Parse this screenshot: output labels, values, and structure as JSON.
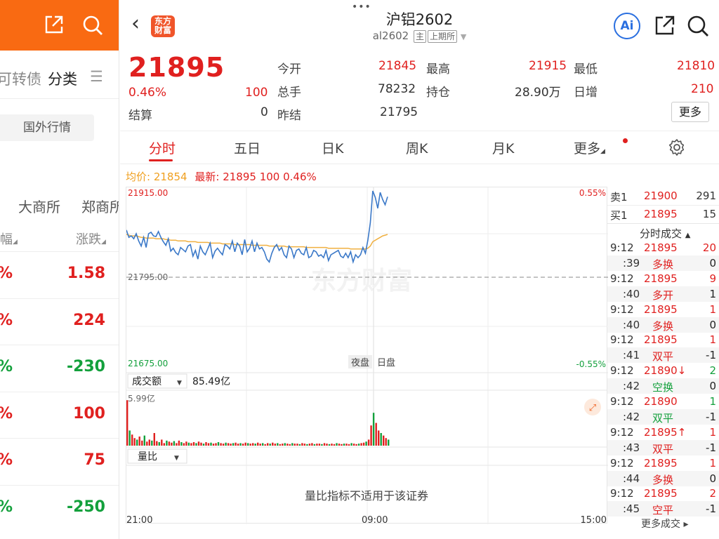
{
  "left_panel": {
    "categories_partial": "可转债",
    "categories_current": "分类",
    "menu_icon": "hamburger-icon",
    "foreign_market_button": "国外行情",
    "exchange_1": "大商所",
    "exchange_2": "郑商所",
    "col_change_pct": "幅",
    "col_change": "涨跌",
    "rows": [
      {
        "pct": "%",
        "change": "1.58",
        "trend": "up"
      },
      {
        "pct": "%",
        "change": "224",
        "trend": "up"
      },
      {
        "pct": "%",
        "change": "-230",
        "trend": "down"
      },
      {
        "pct": "%",
        "change": "100",
        "trend": "up"
      },
      {
        "pct": "%",
        "change": "75",
        "trend": "up"
      },
      {
        "pct": "%",
        "change": "-250",
        "trend": "down"
      }
    ]
  },
  "header": {
    "title": "沪铝2602",
    "code": "al2602",
    "tag_main": "主",
    "exchange": "上期所",
    "logo_text": "东方财富",
    "ai_label": "Ai"
  },
  "quote": {
    "last_price": "21895",
    "change_pct": "0.46%",
    "change": "100",
    "settlement_label": "结算",
    "settlement": "0",
    "open_label": "今开",
    "open": "21845",
    "high_label": "最高",
    "high": "21915",
    "low_label": "最低",
    "low": "21810",
    "volume_label": "总手",
    "volume": "78232",
    "oi_label": "持仓",
    "oi": "28.90万",
    "oi_change_label": "日增",
    "oi_change": "210",
    "prev_settle_label": "昨结",
    "prev_settle": "21795",
    "more_button": "更多"
  },
  "tabs": [
    {
      "label": "分时",
      "active": true
    },
    {
      "label": "五日",
      "active": false
    },
    {
      "label": "日K",
      "active": false
    },
    {
      "label": "周K",
      "active": false
    },
    {
      "label": "月K",
      "active": false
    },
    {
      "label": "更多",
      "active": false
    }
  ],
  "chart_info": {
    "avg_label": "均价:",
    "avg_value": "21854",
    "latest_label": "最新:",
    "latest_value": "21895",
    "latest_change": "100",
    "latest_pct": "0.46%"
  },
  "chart_data": {
    "type": "line",
    "y_max_label": "21915.00",
    "y_mid_label": "21795.00",
    "y_min_label": "21675.00",
    "pct_max_label": "0.55%",
    "pct_min_label": "-0.55%",
    "ylim": [
      21675,
      21915
    ],
    "prev_settle": 21795,
    "session_night_label": "夜盘",
    "session_day_label": "日盘",
    "x_labels": [
      "21:00",
      "09:00",
      "15:00"
    ],
    "price_series": [
      21860,
      21850,
      21852,
      21848,
      21855,
      21845,
      21838,
      21850,
      21836,
      21855,
      21857,
      21852,
      21851,
      21858,
      21850,
      21844,
      21839,
      21848,
      21831,
      21835,
      21829,
      21826,
      21836,
      21833,
      21830,
      21838,
      21840,
      21824,
      21832,
      21820,
      21838,
      21830,
      21826,
      21834,
      21842,
      21822,
      21831,
      21835,
      21830,
      21826,
      21840,
      21838,
      21834,
      21845,
      21830,
      21842,
      21838,
      21826,
      21847,
      21830,
      21835,
      21845,
      21830,
      21842,
      21834,
      21836,
      21830,
      21820,
      21816,
      21828,
      21836,
      21840,
      21832,
      21836,
      21826,
      21822,
      21838,
      21834,
      21822,
      21832,
      21834,
      21828,
      21826,
      21836,
      21822,
      21824,
      21832,
      21830,
      21824,
      21826,
      21822,
      21832,
      21818,
      21826,
      21828,
      21830,
      21832,
      21824,
      21822,
      21828,
      21822,
      21830,
      21816,
      21826,
      21822,
      21826,
      21836,
      21828,
      21846,
      21870,
      21914,
      21905,
      21890,
      21912,
      21902,
      21895,
      21906
    ],
    "avg_series": [
      21854,
      21853,
      21852,
      21852,
      21852,
      21851,
      21850,
      21850,
      21849,
      21849,
      21849,
      21849,
      21848,
      21848,
      21848,
      21848,
      21847,
      21847,
      21846,
      21846,
      21846,
      21845,
      21845,
      21845,
      21845,
      21844,
      21844,
      21844,
      21844,
      21843,
      21843,
      21843,
      21843,
      21843,
      21842,
      21842,
      21842,
      21842,
      21842,
      21841,
      21841,
      21841,
      21841,
      21841,
      21840,
      21840,
      21840,
      21840,
      21840,
      21840,
      21840,
      21839,
      21839,
      21839,
      21839,
      21839,
      21839,
      21839,
      21838,
      21838,
      21838,
      21838,
      21838,
      21838,
      21838,
      21837,
      21837,
      21837,
      21837,
      21837,
      21837,
      21837,
      21837,
      21836,
      21836,
      21836,
      21836,
      21836,
      21836,
      21836,
      21836,
      21836,
      21835,
      21835,
      21835,
      21835,
      21835,
      21835,
      21835,
      21835,
      21835,
      21834,
      21834,
      21834,
      21834,
      21834,
      21834,
      21834,
      21835,
      21838,
      21844,
      21846,
      21848,
      21850,
      21852,
      21853,
      21854
    ],
    "turnover_label": "成交额",
    "turnover_total": "85.49亿",
    "turnover_axis_max": "5.99亿",
    "volume_bars": [
      0.9,
      0.3,
      0.22,
      0.15,
      0.12,
      0.18,
      0.1,
      0.2,
      0.08,
      0.12,
      0.1,
      0.25,
      0.09,
      0.07,
      0.12,
      0.05,
      0.1,
      0.08,
      0.06,
      0.09,
      0.05,
      0.1,
      0.07,
      0.05,
      0.08,
      0.06,
      0.05,
      0.07,
      0.05,
      0.08,
      0.06,
      0.04,
      0.07,
      0.05,
      0.06,
      0.04,
      0.05,
      0.07,
      0.05,
      0.04,
      0.06,
      0.05,
      0.04,
      0.05,
      0.06,
      0.04,
      0.05,
      0.04,
      0.06,
      0.05,
      0.04,
      0.05,
      0.04,
      0.06,
      0.04,
      0.05,
      0.03,
      0.05,
      0.04,
      0.06,
      0.04,
      0.05,
      0.03,
      0.04,
      0.05,
      0.04,
      0.03,
      0.05,
      0.04,
      0.04,
      0.03,
      0.05,
      0.04,
      0.03,
      0.04,
      0.05,
      0.03,
      0.04,
      0.04,
      0.03,
      0.05,
      0.04,
      0.03,
      0.04,
      0.03,
      0.05,
      0.04,
      0.03,
      0.04,
      0.04,
      0.03,
      0.05,
      0.04,
      0.03,
      0.04,
      0.05,
      0.06,
      0.08,
      0.12,
      0.4,
      0.65,
      0.45,
      0.3,
      0.25,
      0.2,
      0.15,
      0.12
    ],
    "volume_colors": "mixed red/green",
    "ratio_label": "量比",
    "ratio_notice": "量比指标不适用于该证券",
    "watermark": "东方财富"
  },
  "orderbook": {
    "ask_label": "卖1",
    "ask_price": "21900",
    "ask_vol": "291",
    "bid_label": "买1",
    "bid_price": "21895",
    "bid_vol": "15",
    "trades_header": "分时成交",
    "more_trades": "更多成交",
    "trades": [
      {
        "time": "9:12",
        "price": "21895",
        "vol": "20",
        "price_color": "red",
        "vol_color": "red"
      },
      {
        "time": ":39",
        "price": "多换",
        "vol": "0",
        "price_color": "red",
        "vol_color": "dark"
      },
      {
        "time": "9:12",
        "price": "21895",
        "vol": "9",
        "price_color": "red",
        "vol_color": "red"
      },
      {
        "time": ":40",
        "price": "多开",
        "vol": "1",
        "price_color": "red",
        "vol_color": "dark"
      },
      {
        "time": "9:12",
        "price": "21895",
        "vol": "1",
        "price_color": "red",
        "vol_color": "red"
      },
      {
        "time": ":40",
        "price": "多换",
        "vol": "0",
        "price_color": "red",
        "vol_color": "dark"
      },
      {
        "time": "9:12",
        "price": "21895",
        "vol": "1",
        "price_color": "red",
        "vol_color": "red"
      },
      {
        "time": ":41",
        "price": "双平",
        "vol": "-1",
        "price_color": "red",
        "vol_color": "dark"
      },
      {
        "time": "9:12",
        "price": "21890↓",
        "vol": "2",
        "price_color": "red",
        "vol_color": "green"
      },
      {
        "time": ":42",
        "price": "空换",
        "vol": "0",
        "price_color": "green",
        "vol_color": "dark"
      },
      {
        "time": "9:12",
        "price": "21890",
        "vol": "1",
        "price_color": "red",
        "vol_color": "green"
      },
      {
        "time": ":42",
        "price": "双平",
        "vol": "-1",
        "price_color": "green",
        "vol_color": "dark"
      },
      {
        "time": "9:12",
        "price": "21895↑",
        "vol": "1",
        "price_color": "red",
        "vol_color": "red"
      },
      {
        "time": ":43",
        "price": "双平",
        "vol": "-1",
        "price_color": "red",
        "vol_color": "dark"
      },
      {
        "time": "9:12",
        "price": "21895",
        "vol": "1",
        "price_color": "red",
        "vol_color": "red"
      },
      {
        "time": ":44",
        "price": "多换",
        "vol": "0",
        "price_color": "red",
        "vol_color": "dark"
      },
      {
        "time": "9:12",
        "price": "21895",
        "vol": "2",
        "price_color": "red",
        "vol_color": "red"
      },
      {
        "time": ":45",
        "price": "空平",
        "vol": "-1",
        "price_color": "red",
        "vol_color": "dark"
      }
    ]
  },
  "colors": {
    "up": "#e0201f",
    "down": "#13a03c",
    "brand": "#f96a12",
    "price_line": "#3a78c8",
    "avg_line": "#f0b040"
  }
}
